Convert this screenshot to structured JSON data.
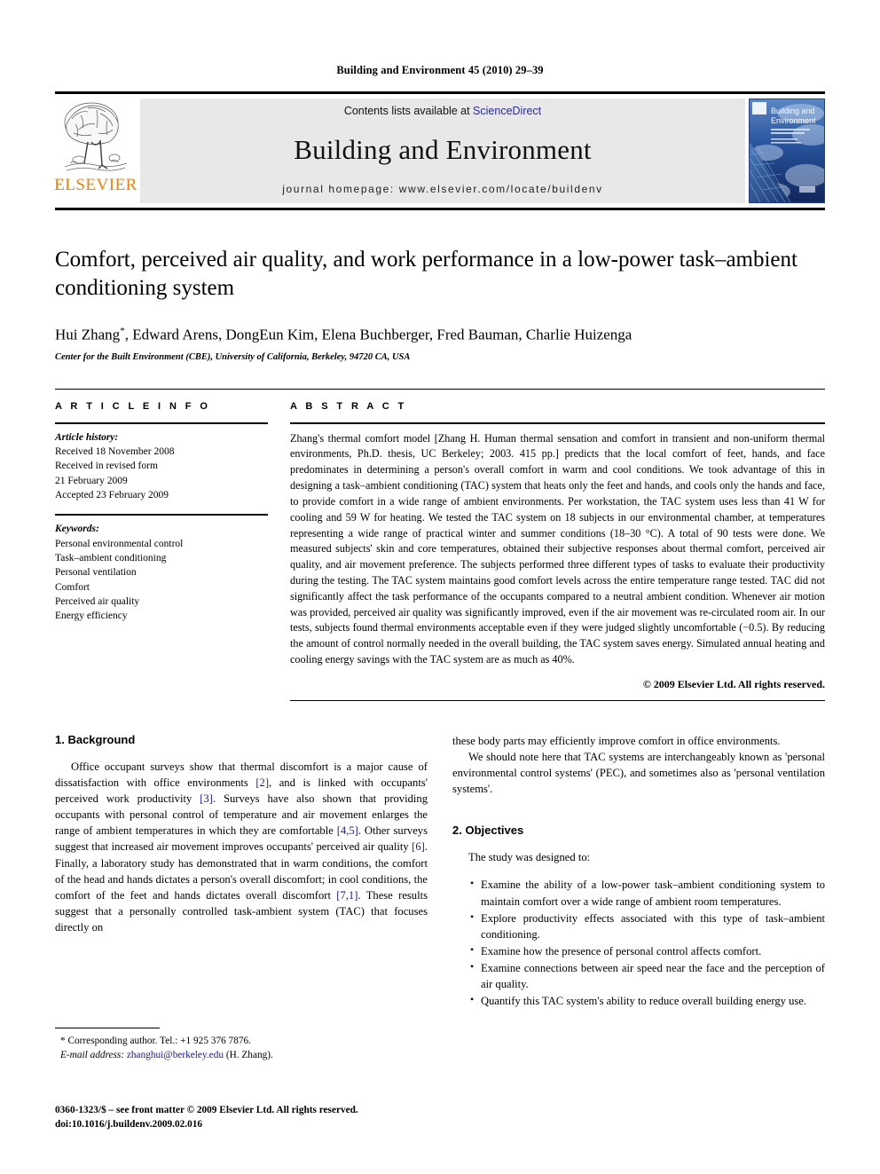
{
  "running_head": "Building and Environment 45 (2010) 29–39",
  "masthead": {
    "publisher_logo_name": "ELSEVIER",
    "contents_prefix": "Contents lists available at ",
    "contents_link": "ScienceDirect",
    "journal_title": "Building and Environment",
    "homepage_label": "journal homepage: www.elsevier.com/locate/buildenv",
    "cover_title_line1": "Building and",
    "cover_title_line2": "Environment"
  },
  "article": {
    "title": "Comfort, perceived air quality, and work performance in a low-power task–ambient conditioning system",
    "authors": "Hui Zhang*, Edward Arens, DongEun Kim, Elena Buchberger, Fred Bauman, Charlie Huizenga",
    "affiliation": "Center for the Built Environment (CBE), University of California, Berkeley, 94720 CA, USA"
  },
  "article_info": {
    "heading": "A R T I C L E    I N F O",
    "history_label": "Article history:",
    "history": [
      "Received 18 November 2008",
      "Received in revised form",
      "21 February 2009",
      "Accepted 23 February 2009"
    ],
    "keywords_label": "Keywords:",
    "keywords": [
      "Personal environmental control",
      "Task–ambient conditioning",
      "Personal ventilation",
      "Comfort",
      "Perceived air quality",
      "Energy efficiency"
    ]
  },
  "abstract": {
    "heading": "A B S T R A C T",
    "text": "Zhang's thermal comfort model [Zhang H. Human thermal sensation and comfort in transient and non-uniform thermal environments, Ph.D. thesis, UC Berkeley; 2003. 415 pp.] predicts that the local comfort of feet, hands, and face predominates in determining a person's overall comfort in warm and cool conditions. We took advantage of this in designing a task–ambient conditioning (TAC) system that heats only the feet and hands, and cools only the hands and face, to provide comfort in a wide range of ambient environments. Per workstation, the TAC system uses less than 41 W for cooling and 59 W for heating. We tested the TAC system on 18 subjects in our environmental chamber, at temperatures representing a wide range of practical winter and summer conditions (18–30 °C). A total of 90 tests were done. We measured subjects' skin and core temperatures, obtained their subjective responses about thermal comfort, perceived air quality, and air movement preference. The subjects performed three different types of tasks to evaluate their productivity during the testing. The TAC system maintains good comfort levels across the entire temperature range tested. TAC did not significantly affect the task performance of the occupants compared to a neutral ambient condition. Whenever air motion was provided, perceived air quality was significantly improved, even if the air movement was re-circulated room air. In our tests, subjects found thermal environments acceptable even if they were judged slightly uncomfortable (−0.5). By reducing the amount of control normally needed in the overall building, the TAC system saves energy. Simulated annual heating and cooling energy savings with the TAC system are as much as 40%.",
    "copyright": "© 2009 Elsevier Ltd. All rights reserved."
  },
  "sections": {
    "background": {
      "heading": "1. Background",
      "para1_part1": "Office occupant surveys show that thermal discomfort is a major cause of dissatisfaction with office environments ",
      "cite1": "[2]",
      "para1_part2": ", and is linked with occupants' perceived work productivity ",
      "cite2": "[3]",
      "para1_part3": ". Surveys have also shown that providing occupants with personal control of temperature and air movement enlarges the range of ambient temperatures in which they are comfortable ",
      "cite3": "[4,5]",
      "para1_part4": ". Other surveys suggest that increased air movement improves occupants' perceived air quality ",
      "cite4": "[6]",
      "para1_part5": ". Finally, a laboratory study has demonstrated that in warm conditions, the comfort of the head and hands dictates a person's overall discomfort; in cool conditions, the comfort of the feet and hands dictates overall discomfort ",
      "cite5": "[7,1]",
      "para1_part6": ". These results suggest that a personally controlled task-ambient system (TAC) that focuses directly on these body parts may efficiently improve comfort in office environments.",
      "para2": "We should note here that TAC systems are interchangeably known as 'personal environmental control systems' (PEC), and sometimes also as 'personal ventilation systems'."
    },
    "objectives": {
      "heading": "2. Objectives",
      "lead_in": "The study was designed to:",
      "items": [
        "Examine the ability of a low-power task–ambient conditioning system to maintain comfort over a wide range of ambient room temperatures.",
        "Explore productivity effects associated with this type of task–ambient conditioning.",
        "Examine how the presence of personal control affects comfort.",
        "Examine connections between air speed near the face and the perception of air quality.",
        "Quantify this TAC system's ability to reduce overall building energy use."
      ]
    }
  },
  "footnotes": {
    "corresponding": "* Corresponding author. Tel.: +1 925 376 7876.",
    "email_label": "E-mail address:",
    "email": "zhanghui@berkeley.edu",
    "email_suffix": "(H. Zhang)."
  },
  "footer": {
    "issn_line": "0360-1323/$ – see front matter © 2009 Elsevier Ltd. All rights reserved.",
    "doi_line": "doi:10.1016/j.buildenv.2009.02.016"
  },
  "colors": {
    "elsevier_orange": "#F08000",
    "link_blue": "#2a2a9c",
    "citation_blue": "#1a1a8c"
  }
}
